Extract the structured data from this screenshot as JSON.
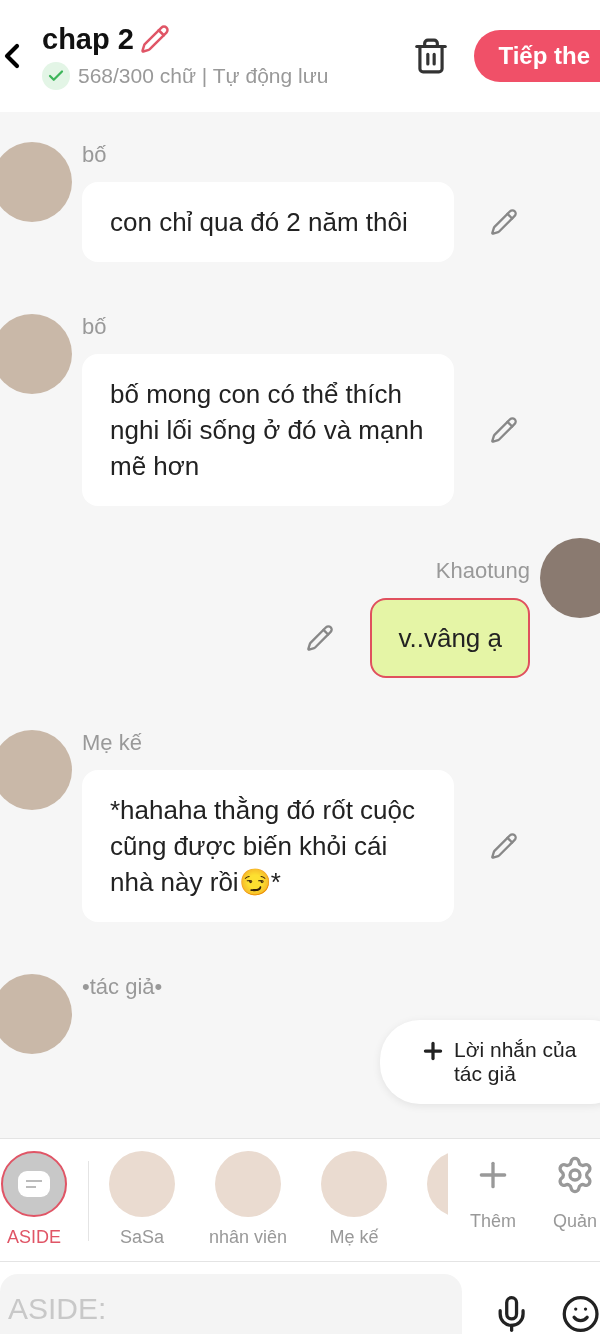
{
  "header": {
    "title": "chap 2",
    "saved": true,
    "status": "568/300 chữ | Tự động lưu",
    "next_button": "Tiếp the"
  },
  "messages": [
    {
      "sender": "bố",
      "text": "con chỉ qua đó 2 năm thôi",
      "kind": "incoming"
    },
    {
      "sender": "bố",
      "text": "bố mong con có thể thích nghi lối sống ở đó và mạnh mẽ hơn",
      "kind": "incoming"
    },
    {
      "sender": "Khaotung",
      "text": "v..vâng ạ",
      "kind": "outgoing"
    },
    {
      "sender": "Mẹ kế",
      "text": "*hahaha thằng đó rốt cuộc cũng được biến khỏi cái nhà này rồi😏*",
      "kind": "incoming"
    },
    {
      "sender": "•tác giả•",
      "kind": "incoming"
    }
  ],
  "author_note_button": "Lời nhắn của tác giả",
  "characters": [
    {
      "name": "ASIDE",
      "kind": "aside",
      "selected": true
    },
    {
      "name": "SaSa",
      "kind": "avatar",
      "selected": false
    },
    {
      "name": "nhân viên",
      "kind": "avatar",
      "selected": false
    },
    {
      "name": "Mẹ kế",
      "kind": "avatar",
      "selected": false
    },
    {
      "kind": "avatar",
      "selected": false
    }
  ],
  "tools": [
    "Thêm",
    "Quản"
  ],
  "input": {
    "placeholder": "ASIDE:"
  }
}
